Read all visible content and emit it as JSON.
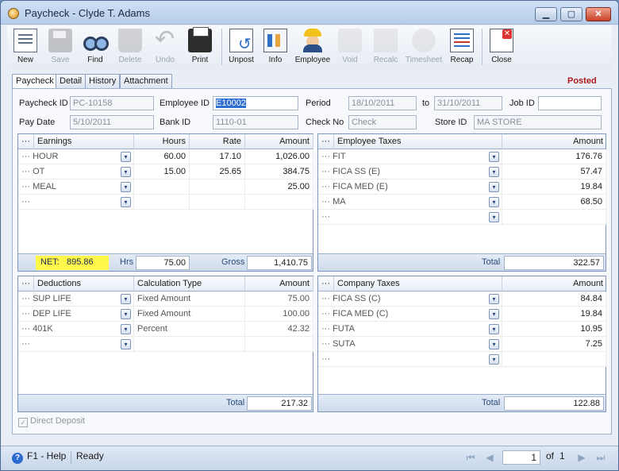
{
  "window": {
    "title": "Paycheck - Clyde T. Adams",
    "controls": {
      "min": "▁",
      "max": "▢",
      "close": "✕"
    }
  },
  "toolbar": {
    "new": "New",
    "save": "Save",
    "find": "Find",
    "delete": "Delete",
    "undo": "Undo",
    "print": "Print",
    "unpost": "Unpost",
    "info": "Info",
    "employee": "Employee",
    "void": "Void",
    "recalc": "Recalc",
    "timesheet": "Timesheet",
    "recap": "Recap",
    "close": "Close"
  },
  "tabs": [
    "Paycheck",
    "Detail",
    "History",
    "Attachment"
  ],
  "status_label": "Posted",
  "header": {
    "paycheck_id_label": "Paycheck ID",
    "paycheck_id": "PC-10158",
    "employee_id_label": "Employee ID",
    "employee_id": "E10002",
    "period_label": "Period",
    "period_from": "18/10/2011",
    "to_label": "to",
    "period_to": "31/10/2011",
    "job_id_label": "Job ID",
    "job_id": "",
    "pay_date_label": "Pay Date",
    "pay_date": "5/10/2011",
    "bank_id_label": "Bank ID",
    "bank_id": "1110-01",
    "check_no_label": "Check No",
    "check_no_placeholder": "Check",
    "store_id_label": "Store ID",
    "store_id": "MA STORE"
  },
  "earnings": {
    "menu": "···",
    "columns": [
      "Earnings",
      "Hours",
      "Rate",
      "Amount"
    ],
    "rows": [
      {
        "name": "HOUR",
        "hours": "60.00",
        "rate": "17.10",
        "amount": "1,026.00"
      },
      {
        "name": "OT",
        "hours": "15.00",
        "rate": "25.65",
        "amount": "384.75"
      },
      {
        "name": "MEAL",
        "hours": "",
        "rate": "",
        "amount": "25.00"
      },
      {
        "name": "",
        "hours": "",
        "rate": "",
        "amount": ""
      }
    ],
    "net_label": "NET:",
    "net_value": "895.86",
    "hrs_label": "Hrs",
    "hrs_value": "75.00",
    "gross_label": "Gross",
    "gross_value": "1,410.75"
  },
  "employee_taxes": {
    "menu": "···",
    "columns": [
      "Employee Taxes",
      "Amount"
    ],
    "rows": [
      {
        "name": "FIT",
        "amount": "176.76"
      },
      {
        "name": "FICA SS (E)",
        "amount": "57.47"
      },
      {
        "name": "FICA MED (E)",
        "amount": "19.84"
      },
      {
        "name": "MA",
        "amount": "68.50"
      },
      {
        "name": "",
        "amount": ""
      }
    ],
    "total_label": "Total",
    "total_value": "322.57"
  },
  "deductions": {
    "menu": "···",
    "columns": [
      "Deductions",
      "Calculation Type",
      "Amount"
    ],
    "rows": [
      {
        "name": "SUP LIFE",
        "calc": "Fixed Amount",
        "amount": "75.00"
      },
      {
        "name": "DEP LIFE",
        "calc": "Fixed Amount",
        "amount": "100.00"
      },
      {
        "name": "401K",
        "calc": "Percent",
        "amount": "42.32"
      },
      {
        "name": "",
        "calc": "",
        "amount": ""
      }
    ],
    "total_label": "Total",
    "total_value": "217.32"
  },
  "company_taxes": {
    "menu": "···",
    "columns": [
      "Company Taxes",
      "Amount"
    ],
    "rows": [
      {
        "name": "FICA SS (C)",
        "amount": "84.84"
      },
      {
        "name": "FICA MED (C)",
        "amount": "19.84"
      },
      {
        "name": "FUTA",
        "amount": "10.95"
      },
      {
        "name": "SUTA",
        "amount": "7.25"
      },
      {
        "name": "",
        "amount": ""
      }
    ],
    "total_label": "Total",
    "total_value": "122.88"
  },
  "row_prefix": "···",
  "direct_deposit": {
    "label": "Direct Deposit",
    "checked": true
  },
  "statusbar": {
    "help": "F1 - Help",
    "ready": "Ready",
    "page": "1",
    "of_label": "of",
    "pages": "1"
  },
  "icons": {
    "dropdown": "▾",
    "help": "?",
    "check": "✓",
    "first": "⏮",
    "prev": "◀",
    "next": "▶",
    "last": "⏭"
  }
}
